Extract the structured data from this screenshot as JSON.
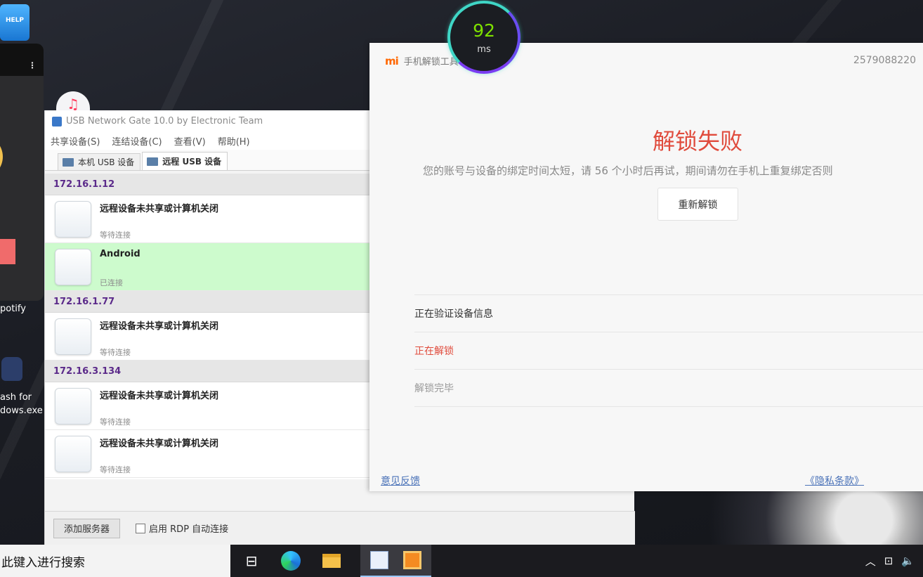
{
  "desktop": {
    "help_icon_text": "HELP",
    "spotify_label": "potify",
    "clash_label_1": "ash for",
    "clash_label_2": "dows.exe"
  },
  "ping": {
    "value": "92",
    "unit": "ms"
  },
  "usb_gate": {
    "title": "USB Network Gate 10.0 by Electronic Team",
    "menu": [
      "共享设备(S)",
      "连结设备(C)",
      "查看(V)",
      "帮助(H)"
    ],
    "tabs": [
      "本机 USB 设备",
      "远程 USB 设备"
    ],
    "groups": [
      {
        "ip": "172.16.1.12",
        "devices": [
          {
            "name": "远程设备未共享或计算机关闭",
            "status": "等待连接",
            "connected": false
          },
          {
            "name": "Android",
            "status": "已连接",
            "connected": true
          }
        ]
      },
      {
        "ip": "172.16.1.77",
        "devices": [
          {
            "name": "远程设备未共享或计算机关闭",
            "status": "等待连接",
            "connected": false
          }
        ]
      },
      {
        "ip": "172.16.3.134",
        "devices": [
          {
            "name": "远程设备未共享或计算机关闭",
            "status": "等待连接",
            "connected": false
          },
          {
            "name": "远程设备未共享或计算机关闭",
            "status": "等待连接",
            "connected": false
          }
        ]
      }
    ],
    "add_server_label": "添加服务器",
    "rdp_label": "启用 RDP 自动连接"
  },
  "mi_unlock": {
    "logo": "mi",
    "app_title": "手机解锁工具",
    "account": "2579088220",
    "heading": "解锁失败",
    "message": "您的账号与设备的绑定时间太短，请 56 个小时后再试，期间请勿在手机上重复绑定否则",
    "retry_label": "重新解锁",
    "steps": [
      {
        "label": "正在验证设备信息",
        "state": "done"
      },
      {
        "label": "正在解锁",
        "state": "active"
      },
      {
        "label": "解锁完毕",
        "state": "pending"
      }
    ],
    "feedback_link": "意见反馈",
    "privacy_link": "《隐私条款》"
  },
  "taskbar": {
    "search_placeholder": "此键入进行搜索",
    "apps": [
      "task-view",
      "edge",
      "file-explorer",
      "usb-network-gate",
      "mi-unlock-tool"
    ],
    "tray": [
      "^",
      "network",
      "volume"
    ]
  }
}
